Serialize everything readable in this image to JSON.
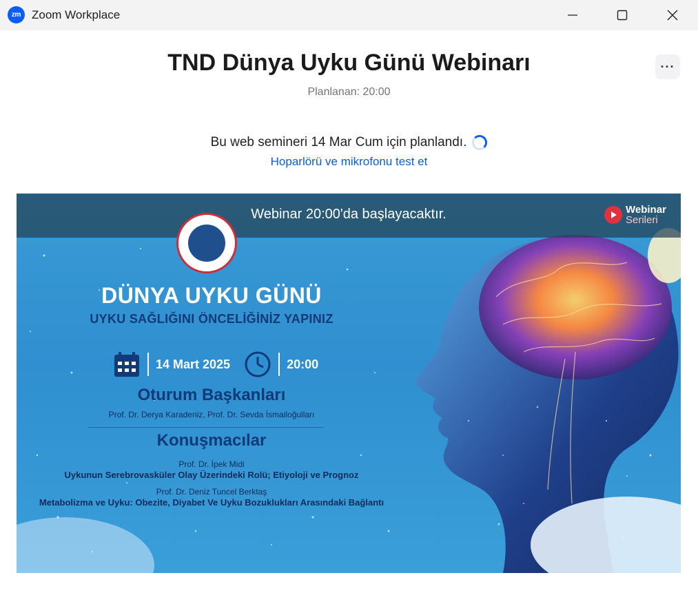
{
  "window": {
    "app_title": "Zoom Workplace",
    "logo_text": "zm"
  },
  "header": {
    "title": "TND Dünya Uyku Günü Webinarı",
    "scheduled": "Planlanan: 20:00",
    "more_label": "···"
  },
  "schedule": {
    "message": "Bu web semineri 14 Mar Cum için planlandı.",
    "test_link": "Hoparlörü ve mikrofonu test et"
  },
  "banner": {
    "status": "Webinar 20:00'da başlayacaktır.",
    "badge_line1": "Webinar",
    "badge_line2": "Serileri",
    "title": "DÜNYA UYKU GÜNÜ",
    "subtitle": "UYKU SAĞLIĞINI ÖNCELİĞİNİZ YAPINIZ",
    "date": "14 Mart 2025",
    "time": "20:00",
    "chairs_heading": "Oturum Başkanları",
    "chairs": "Prof. Dr. Derya Karadeniz, Prof. Dr. Sevda İsmailoğulları",
    "speakers_heading": "Konuşmacılar",
    "speaker1_name": "Prof. Dr. İpek Midi",
    "speaker1_topic": "Uykunun Serebrovasküler Olay Üzerindeki Rolü; Etiyoloji ve Prognoz",
    "speaker2_name": "Prof. Dr. Deniz Tuncel Berktaş",
    "speaker2_topic": "Metabolizma ve Uyku: Obezite, Diyabet Ve Uyku Bozuklukları Arasındaki Bağlantı"
  },
  "colors": {
    "zoom_blue": "#0b5cff",
    "link_blue": "#0e5cd6",
    "banner_navy": "#123a79",
    "seal_red": "#cc2e3a"
  }
}
